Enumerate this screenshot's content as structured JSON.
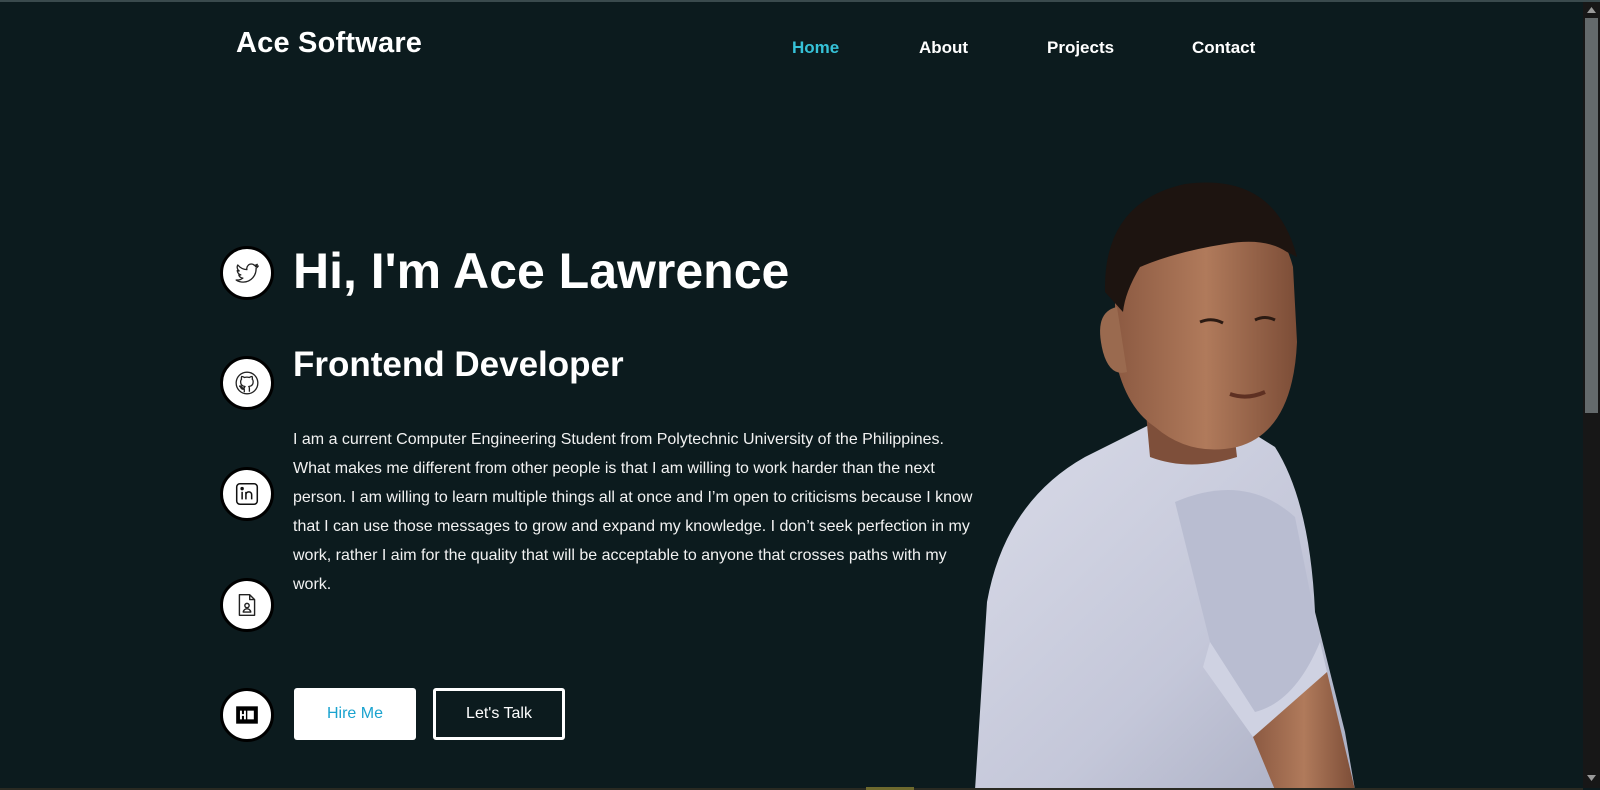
{
  "header": {
    "brand": "Ace Software",
    "nav": [
      {
        "label": "Home",
        "active": true
      },
      {
        "label": "About",
        "active": false
      },
      {
        "label": "Projects",
        "active": false
      },
      {
        "label": "Contact",
        "active": false
      }
    ]
  },
  "hero": {
    "greeting": "Hi, I'm Ace Lawrence",
    "role": "Frontend Developer",
    "bio": "I am a current Computer Engineering Student from Polytechnic University of the Philippines. What makes me different from other people is that I am willing to work harder than the next person. I am willing to learn multiple things all at once and I’m open to criticisms because I know that I can use those messages to grow and expand my knowledge. I don’t seek perfection in my work, rather I aim for the quality that will be acceptable to anyone that crosses paths with my work.",
    "hire_label": "Hire Me",
    "talk_label": "Let's Talk"
  },
  "social_icons": [
    "twitter-icon",
    "github-icon",
    "linkedin-icon",
    "resume-icon",
    "hackerrank-icon"
  ],
  "colors": {
    "background": "#0c1b1e",
    "accent": "#36c2d8",
    "hire_text": "#1aa3cf",
    "text": "#ffffff"
  }
}
